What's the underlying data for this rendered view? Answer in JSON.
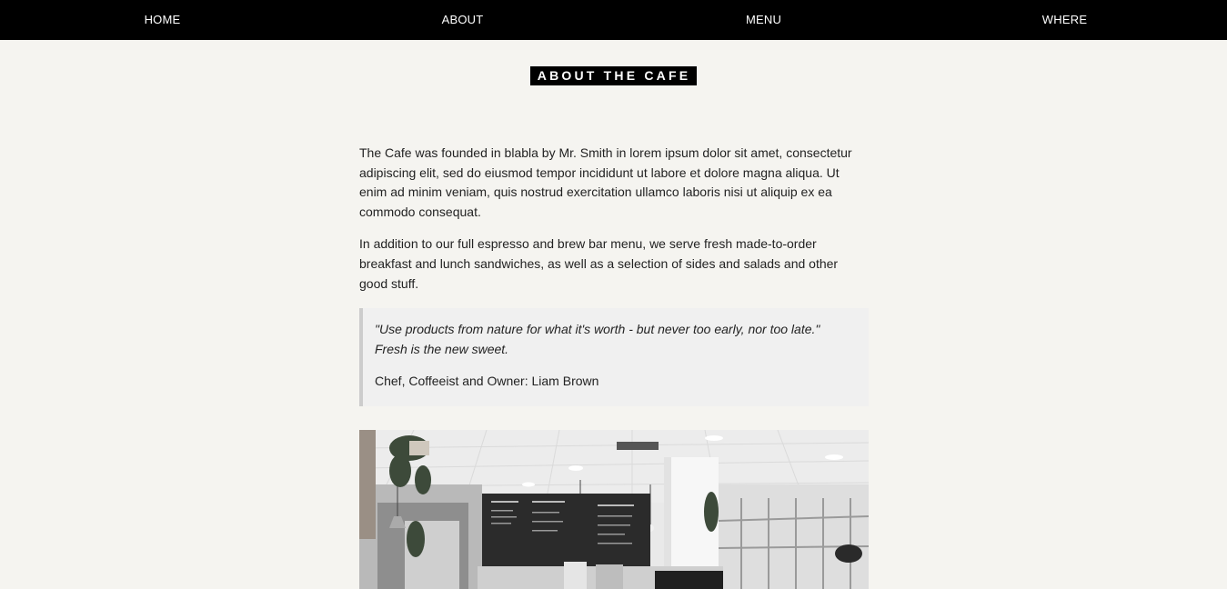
{
  "nav": {
    "items": [
      {
        "label": "HOME"
      },
      {
        "label": "ABOUT"
      },
      {
        "label": "MENU"
      },
      {
        "label": "WHERE"
      }
    ]
  },
  "about": {
    "title": "ABOUT THE CAFE",
    "paragraphs": [
      "The Cafe was founded in blabla by Mr. Smith in lorem ipsum dolor sit amet, consectetur adipiscing elit, sed do eiusmod tempor incididunt ut labore et dolore magna aliqua. Ut enim ad minim veniam, quis nostrud exercitation ullamco laboris nisi ut aliquip ex ea commodo consequat.",
      "In addition to our full espresso and brew bar menu, we serve fresh made-to-order breakfast and lunch sandwiches, as well as a selection of sides and salads and other good stuff."
    ],
    "quote": {
      "text": "\"Use products from nature for what it's worth - but never too early, nor too late.\" Fresh is the new sweet.",
      "author": "Chef, Coffeeist and Owner: Liam Brown"
    }
  },
  "colors": {
    "nav_bg": "#000000",
    "page_bg": "#f5f4f0",
    "quote_bg": "#f0f0f0",
    "quote_border": "#cccccc"
  }
}
